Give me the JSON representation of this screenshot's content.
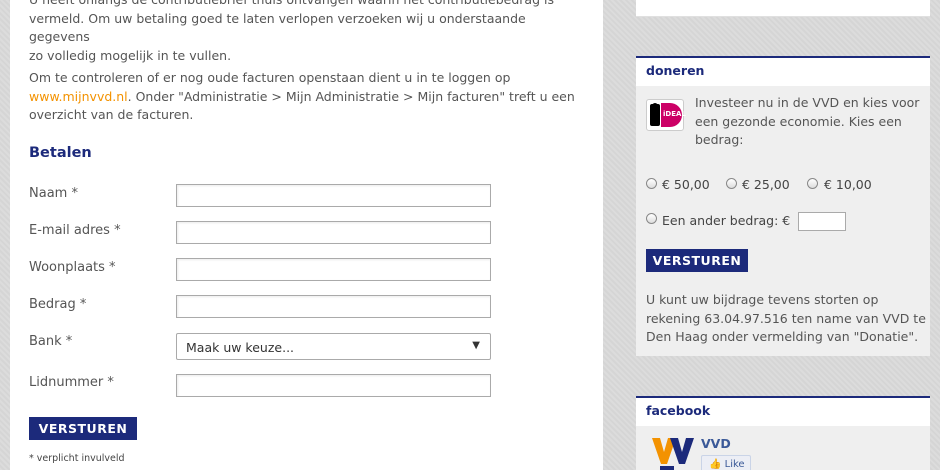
{
  "intro": {
    "p1_line1": "U heeft onlangs de contributiebrief thuis ontvangen waarin het contributiebedrag is",
    "p1_line2": "vermeld. Om uw betaling goed te laten verlopen verzoeken wij u onderstaande gegevens",
    "p1_line3": "zo volledig mogelijk in te vullen.",
    "p2_line1": "Om te controleren of er nog oude facturen openstaan dient u in te loggen op",
    "p2_link": "www.mijnvvd.nl",
    "p2_line2_rest": ". Onder \"Administratie > Mijn Administratie > Mijn facturen\" treft u een",
    "p2_line3": "overzicht van de facturen."
  },
  "form": {
    "title": "Betalen",
    "fields": [
      {
        "label": "Naam *",
        "value": ""
      },
      {
        "label": "E-mail adres *",
        "value": ""
      },
      {
        "label": "Woonplaats *",
        "value": ""
      },
      {
        "label": "Bedrag *",
        "value": ""
      },
      {
        "label": "Bank *",
        "selected": "Maak uw keuze..."
      },
      {
        "label": "Lidnummer *",
        "value": ""
      }
    ],
    "submit_label": "VERSTUREN",
    "footnote": "* verplicht invulveld"
  },
  "doneren": {
    "title": "doneren",
    "text_line1": "Investeer nu in de VVD en kies voor",
    "text_line2": "een gezonde economie. Kies een",
    "text_line3": "bedrag:",
    "ideal_logo_text": "iDEAL",
    "options": [
      "€ 50,00",
      "€ 25,00",
      "€ 10,00"
    ],
    "other_label": "Een ander bedrag: €",
    "submit_label": "VERSTUREN",
    "note_line1": "U kunt uw bijdrage tevens storten op",
    "note_line2": "rekening 63.04.97.516 ten name van VVD te",
    "note_line3": "Den Haag onder vermelding van \"Donatie\"."
  },
  "facebook": {
    "title": "facebook",
    "page_name": "VVD",
    "like_label": "Like"
  },
  "colors": {
    "brand_blue": "#1c2a7b",
    "link_orange": "#f39200",
    "facebook_blue": "#3b5998",
    "background": "#d9d9d9"
  }
}
